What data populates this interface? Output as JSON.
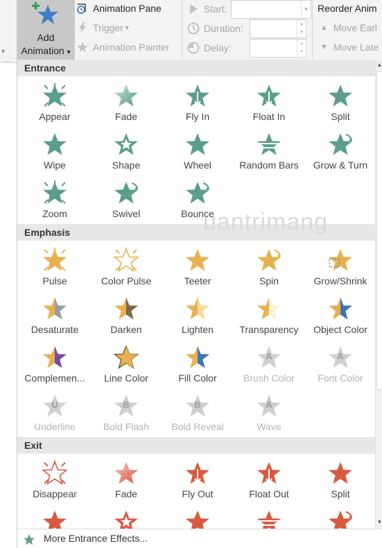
{
  "ribbon": {
    "add_animation": {
      "line1": "Add",
      "line2": "Animation",
      "arrow": "▾",
      "icon": "add-star-icon"
    },
    "animation_pane": "Animation Pane",
    "trigger": "Trigger",
    "trigger_arrow": "▾",
    "animation_painter": "Animation Painter",
    "start": "Start:",
    "duration": "Duration:",
    "delay": "Delay:",
    "reorder": "Reorder Anim",
    "move_earlier": "Move Earl",
    "move_later": "Move Late"
  },
  "gallery": {
    "sections": [
      {
        "title": "Entrance",
        "effects": [
          {
            "label": "Appear",
            "icon": "appear-icon",
            "color": "#5b9e8c",
            "enabled": true
          },
          {
            "label": "Fade",
            "icon": "fade-icon",
            "color": "#5b9e8c",
            "enabled": true
          },
          {
            "label": "Fly In",
            "icon": "fly-in-icon",
            "color": "#5b9e8c",
            "enabled": true
          },
          {
            "label": "Float In",
            "icon": "float-in-icon",
            "color": "#5b9e8c",
            "enabled": true
          },
          {
            "label": "Split",
            "icon": "split-icon",
            "color": "#5b9e8c",
            "enabled": true
          },
          {
            "label": "Wipe",
            "icon": "wipe-icon",
            "color": "#5b9e8c",
            "enabled": true
          },
          {
            "label": "Shape",
            "icon": "shape-icon",
            "color": "#5b9e8c",
            "enabled": true
          },
          {
            "label": "Wheel",
            "icon": "wheel-icon",
            "color": "#5b9e8c",
            "enabled": true
          },
          {
            "label": "Random Bars",
            "icon": "random-bars-icon",
            "color": "#5b9e8c",
            "enabled": true
          },
          {
            "label": "Grow & Turn",
            "icon": "grow-turn-icon",
            "color": "#5b9e8c",
            "enabled": true
          },
          {
            "label": "Zoom",
            "icon": "zoom-icon",
            "color": "#5b9e8c",
            "enabled": true
          },
          {
            "label": "Swivel",
            "icon": "swivel-icon",
            "color": "#5b9e8c",
            "enabled": true
          },
          {
            "label": "Bounce",
            "icon": "bounce-icon",
            "color": "#5b9e8c",
            "enabled": true
          }
        ]
      },
      {
        "title": "Emphasis",
        "effects": [
          {
            "label": "Pulse",
            "icon": "pulse-icon",
            "color": "#e8b14f",
            "enabled": true
          },
          {
            "label": "Color Pulse",
            "icon": "color-pulse-icon",
            "color": "#e8b14f",
            "enabled": true
          },
          {
            "label": "Teeter",
            "icon": "teeter-icon",
            "color": "#e8b14f",
            "enabled": true
          },
          {
            "label": "Spin",
            "icon": "spin-icon",
            "color": "#e8b14f",
            "enabled": true
          },
          {
            "label": "Grow/Shrink",
            "icon": "grow-shrink-icon",
            "color": "#e8b14f",
            "enabled": true
          },
          {
            "label": "Desaturate",
            "icon": "desaturate-icon",
            "color": "#e8b14f",
            "enabled": true
          },
          {
            "label": "Darken",
            "icon": "darken-icon",
            "color": "#e8b14f",
            "enabled": true
          },
          {
            "label": "Lighten",
            "icon": "lighten-icon",
            "color": "#e8b14f",
            "enabled": true
          },
          {
            "label": "Transparency",
            "icon": "transparency-icon",
            "color": "#e8b14f",
            "enabled": true
          },
          {
            "label": "Object Color",
            "icon": "object-color-icon",
            "color": "#e8b14f",
            "enabled": true
          },
          {
            "label": "Complemen...",
            "icon": "complementary-color-icon",
            "color": "#e8b14f",
            "enabled": true
          },
          {
            "label": "Line Color",
            "icon": "line-color-icon",
            "color": "#e8b14f",
            "enabled": true
          },
          {
            "label": "Fill Color",
            "icon": "fill-color-icon",
            "color": "#e8b14f",
            "enabled": true
          },
          {
            "label": "Brush Color",
            "icon": "brush-color-icon",
            "color": "#cfcfcf",
            "enabled": false
          },
          {
            "label": "Font Color",
            "icon": "font-color-icon",
            "color": "#cfcfcf",
            "enabled": false
          },
          {
            "label": "Underline",
            "icon": "underline-icon",
            "color": "#cfcfcf",
            "enabled": false
          },
          {
            "label": "Bold Flash",
            "icon": "bold-flash-icon",
            "color": "#cfcfcf",
            "enabled": false
          },
          {
            "label": "Bold Reveal",
            "icon": "bold-reveal-icon",
            "color": "#cfcfcf",
            "enabled": false
          },
          {
            "label": "Wave",
            "icon": "wave-icon",
            "color": "#cfcfcf",
            "enabled": false
          }
        ]
      },
      {
        "title": "Exit",
        "effects": [
          {
            "label": "Disappear",
            "icon": "disappear-icon",
            "color": "#d9593f",
            "enabled": true
          },
          {
            "label": "Fade",
            "icon": "fade-out-icon",
            "color": "#d9593f",
            "enabled": true
          },
          {
            "label": "Fly Out",
            "icon": "fly-out-icon",
            "color": "#d9593f",
            "enabled": true
          },
          {
            "label": "Float Out",
            "icon": "float-out-icon",
            "color": "#d9593f",
            "enabled": true
          },
          {
            "label": "Split",
            "icon": "split-out-icon",
            "color": "#d9593f",
            "enabled": true
          },
          {
            "label": "",
            "icon": "wipe-out-icon",
            "color": "#d9593f",
            "enabled": true
          },
          {
            "label": "",
            "icon": "shape-out-icon",
            "color": "#d9593f",
            "enabled": true
          },
          {
            "label": "",
            "icon": "wheel-out-icon",
            "color": "#d9593f",
            "enabled": true
          },
          {
            "label": "",
            "icon": "random-bars-out-icon",
            "color": "#d9593f",
            "enabled": true
          },
          {
            "label": "",
            "icon": "shrink-turn-icon",
            "color": "#d9593f",
            "enabled": true
          }
        ]
      }
    ],
    "footer": {
      "label": "More Entrance Effects...",
      "icon": "star-icon",
      "color": "#5b9e8c"
    },
    "watermark": "uantrimang",
    "colors": {
      "entrance": "#5b9e8c",
      "emphasis": "#e8b14f",
      "exit": "#d9593f",
      "disabled": "#cfcfcf"
    }
  }
}
